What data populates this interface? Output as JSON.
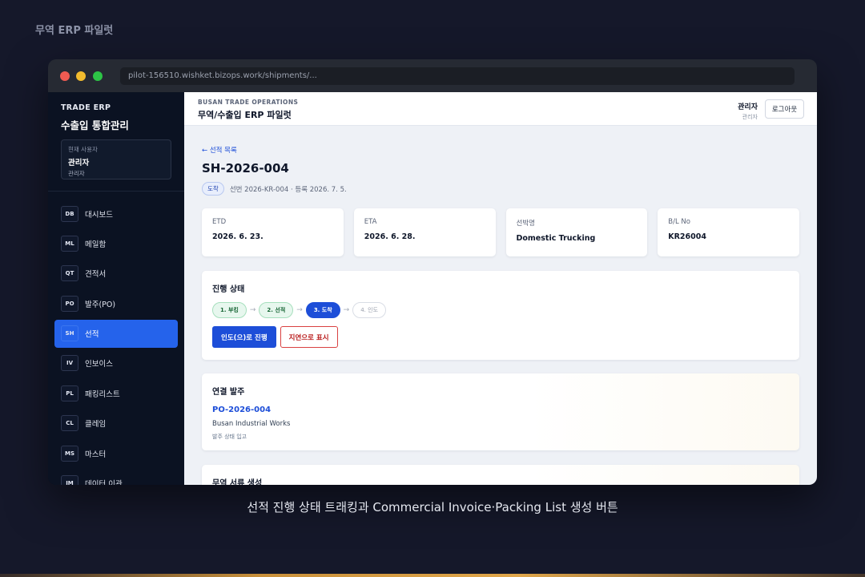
{
  "page_label": "무역 ERP 파일럿",
  "caption": "선적 진행 상태 트래킹과 Commercial Invoice·Packing List 생성 버튼",
  "browser": {
    "url": "pilot-156510.wishket.bizops.work/shipments/..."
  },
  "sidebar": {
    "brand_top": "TRADE ERP",
    "brand_main": "수출입 통합관리",
    "user": {
      "caption": "현재 사용자",
      "name": "관리자",
      "role": "관리자"
    },
    "items": [
      {
        "code": "DB",
        "label": "대시보드"
      },
      {
        "code": "ML",
        "label": "메일함"
      },
      {
        "code": "QT",
        "label": "견적서"
      },
      {
        "code": "PO",
        "label": "발주(PO)"
      },
      {
        "code": "SH",
        "label": "선적"
      },
      {
        "code": "IV",
        "label": "인보이스"
      },
      {
        "code": "PL",
        "label": "패킹리스트"
      },
      {
        "code": "CL",
        "label": "클레임"
      },
      {
        "code": "MS",
        "label": "마스터"
      },
      {
        "code": "IM",
        "label": "데이터 이관"
      }
    ],
    "active_index": 4
  },
  "header": {
    "small": "BUSAN TRADE OPERATIONS",
    "title": "무역/수출입 ERP 파일럿",
    "user_name": "관리자",
    "user_role": "관리자",
    "logout": "로그아웃"
  },
  "shipment": {
    "back_link": "← 선적 목록",
    "title": "SH-2026-004",
    "status_badge": "도착",
    "meta": "선번 2026-KR-004 · 등록 2026. 7. 5.",
    "cards": [
      {
        "label": "ETD",
        "value": "2026. 6. 23."
      },
      {
        "label": "ETA",
        "value": "2026. 6. 28."
      },
      {
        "label": "선박명",
        "value": "Domestic Trucking"
      },
      {
        "label": "B/L No",
        "value": "KR26004"
      }
    ]
  },
  "progress": {
    "title": "진행 상태",
    "steps": [
      {
        "label": "1. 부킹",
        "state": "done"
      },
      {
        "label": "2. 선적",
        "state": "done"
      },
      {
        "label": "3. 도착",
        "state": "current"
      },
      {
        "label": "4. 인도",
        "state": "pending"
      }
    ],
    "arrow": "→",
    "primary_action": "인도(으)로 진행",
    "danger_action": "지연으로 표시"
  },
  "linked_po": {
    "title": "연결 발주",
    "po_number": "PO-2026-004",
    "company": "Busan Industrial Works",
    "status": "발주 상태 입고"
  },
  "docs": {
    "title": "무역 서류 생성"
  }
}
